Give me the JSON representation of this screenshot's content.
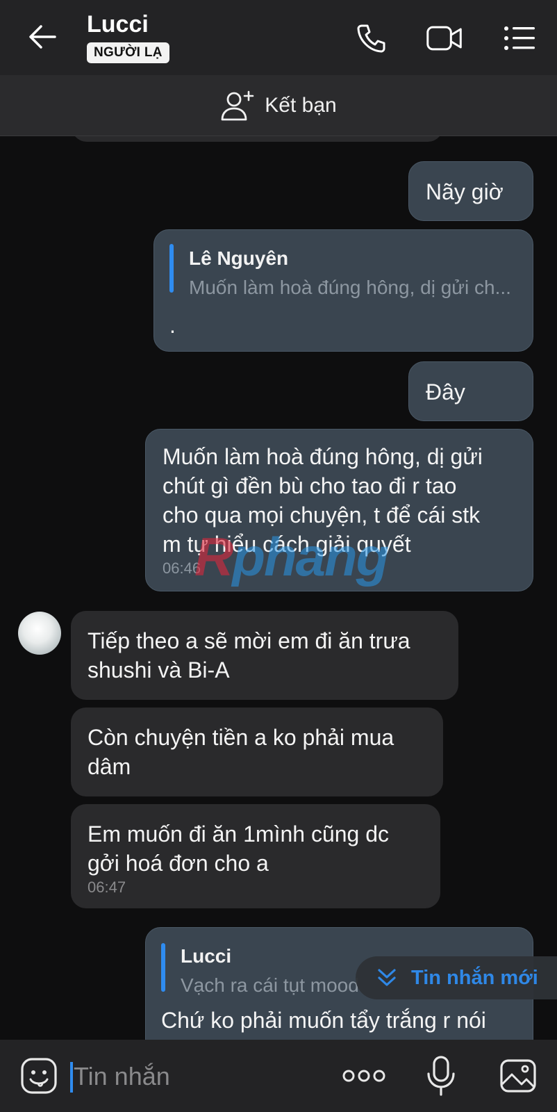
{
  "header": {
    "title": "Lucci",
    "badge": "NGƯỜI LẠ",
    "icons": [
      "back-arrow-icon",
      "phone-icon",
      "video-camera-icon",
      "list-menu-icon"
    ]
  },
  "friend_bar": {
    "label": "Kết bạn",
    "icon": "add-user-icon"
  },
  "messages": [
    {
      "id": "m1",
      "side": "out",
      "text": "Nãy giờ"
    },
    {
      "id": "m2",
      "side": "out",
      "quote_name": "Lê Nguyên",
      "quote_text": "Muốn làm hoà đúng hông, dị gửi ch...",
      "text": "."
    },
    {
      "id": "m3",
      "side": "out",
      "text": "Đây"
    },
    {
      "id": "m4",
      "side": "out",
      "lines": [
        "Muốn làm hoà đúng hông, dị gửi",
        "chút gì đền bù cho tao đi r tao",
        "cho qua mọi chuyện, t để cái stk",
        "m tự hiểu cách giải quyết"
      ],
      "time": "06:46"
    },
    {
      "id": "m5",
      "side": "in",
      "lines": [
        "Tiếp theo a sẽ mời em đi ăn trưa",
        "shushi và Bi-A"
      ]
    },
    {
      "id": "m6",
      "side": "in",
      "lines": [
        "Còn chuyện tiền a ko phải mua",
        "dâm"
      ]
    },
    {
      "id": "m7",
      "side": "in",
      "lines": [
        "Em muốn đi ăn 1mình cũng dc",
        "gởi hoá đơn cho a"
      ],
      "time": "06:47"
    },
    {
      "id": "m8",
      "side": "out",
      "quote_name": "Lucci",
      "quote_text": "Vạch ra cái tụt mood",
      "text": "Chứ ko phải muốn tẩy trắng r nói"
    }
  ],
  "watermark": {
    "part1": "R",
    "part2": "phang"
  },
  "new_message_button": {
    "label": "Tin nhắn mới",
    "icon": "double-chevron-down-icon"
  },
  "input": {
    "placeholder": "Tin nhắn",
    "icons": [
      "sticker-icon",
      "more-dots-icon",
      "microphone-icon",
      "image-icon"
    ]
  },
  "colors": {
    "accent": "#2f8cf0",
    "outgoing_bubble": "#3a4550",
    "incoming_bubble": "#2a2a2c",
    "header_bg": "#232325"
  }
}
